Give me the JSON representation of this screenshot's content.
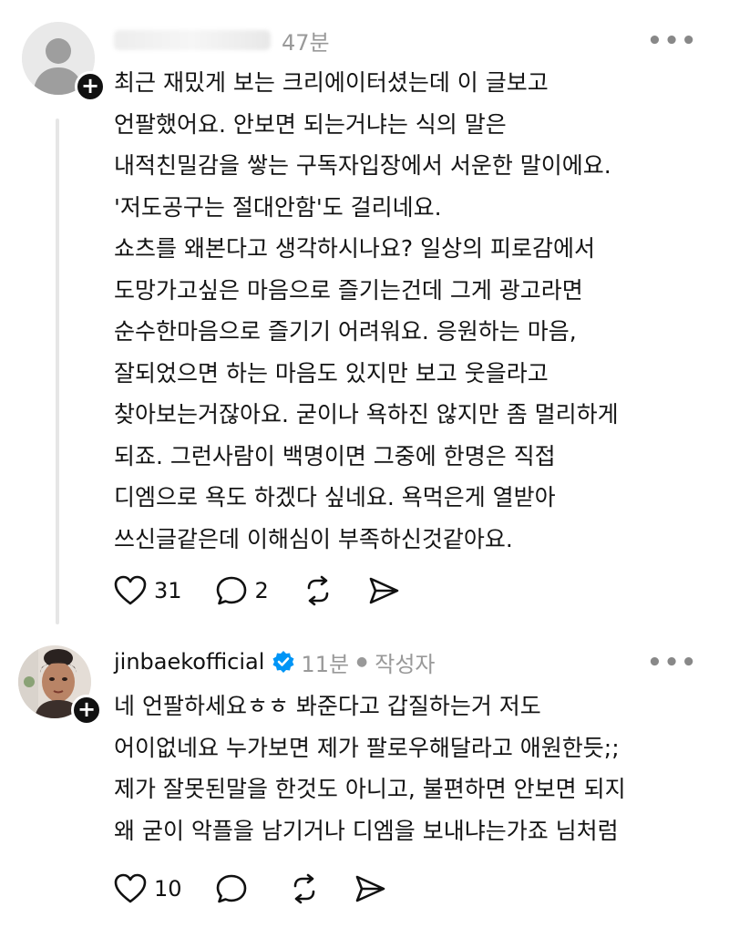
{
  "posts": [
    {
      "username": "",
      "time": "47분",
      "body": "최근 재밌게 보는 크리에이터셨는데 이 글보고\n언팔했어요. 안보면 되는거냐는 식의 말은\n내적친밀감을 쌓는 구독자입장에서 서운한 말이에요.\n'저도공구는 절대안함'도 걸리네요.\n쇼츠를 왜본다고 생각하시나요? 일상의 피로감에서\n도망가고싶은 마음으로 즐기는건데 그게 광고라면\n순수한마음으로 즐기기 어려워요.  응원하는 마음,\n잘되었으면 하는 마음도 있지만 보고 웃을라고\n찾아보는거잖아요. 굳이나 욕하진 않지만 좀 멀리하게\n되죠. 그런사람이 백명이면 그중에 한명은 직접\n디엠으로 욕도 하겠다 싶네요. 욕먹은게 열받아\n쓰신글같은데 이해심이 부족하신것같아요.",
      "likes": "31",
      "replies": "2",
      "verified": false,
      "author_tag": ""
    },
    {
      "username": "jinbaekofficial",
      "time": "11분",
      "author_tag": "작성자",
      "verified": true,
      "body": "네 언팔하세요ㅎㅎ 봐준다고 갑질하는거 저도\n어이없네요 누가보면 제가 팔로우해달라고 애원한듯;;\n제가 잘못된말을 한것도 아니고, 불편하면 안보면 되지\n왜 굳이 악플을 남기거나 디엠을 보내냐는가죠 님처럼",
      "likes": "10",
      "replies": ""
    }
  ],
  "icons": {
    "more": "more-icon",
    "like": "heart-icon",
    "reply": "comment-icon",
    "repost": "repost-icon",
    "share": "share-icon",
    "follow": "plus-icon",
    "verified": "verified-badge-icon"
  },
  "colors": {
    "text": "#111111",
    "muted": "#999999",
    "verified": "#0095f6",
    "thread_line": "#e6e6e6"
  }
}
